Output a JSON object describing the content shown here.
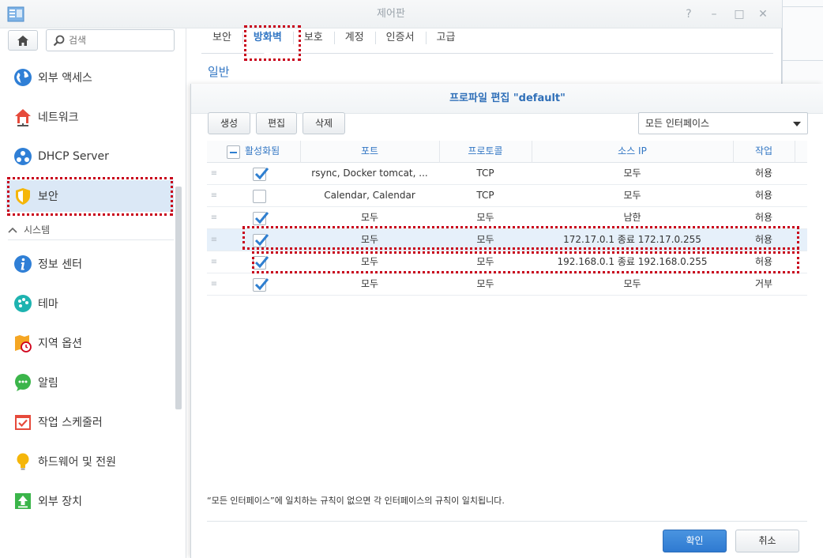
{
  "window": {
    "title": "제어판"
  },
  "sidebar": {
    "search_placeholder": "검색",
    "items": [
      {
        "label": "외부 액세스",
        "icon": "globe-icon"
      },
      {
        "label": "네트워크",
        "icon": "network-house-icon"
      },
      {
        "label": "DHCP Server",
        "icon": "dhcp-icon"
      },
      {
        "label": "보안",
        "icon": "shield-icon"
      },
      {
        "label": "정보 센터",
        "icon": "info-icon"
      },
      {
        "label": "테마",
        "icon": "palette-icon"
      },
      {
        "label": "지역 옵션",
        "icon": "map-clock-icon"
      },
      {
        "label": "알림",
        "icon": "chat-bubble-icon"
      },
      {
        "label": "작업 스케줄러",
        "icon": "calendar-check-icon"
      },
      {
        "label": "하드웨어 및 전원",
        "icon": "lightbulb-icon"
      },
      {
        "label": "외부 장치",
        "icon": "upload-arrow-icon"
      }
    ],
    "section_system": "시스템"
  },
  "tabs": [
    "보안",
    "방화벽",
    "보호",
    "계정",
    "인증서",
    "고급"
  ],
  "general_label": "일반",
  "dialog": {
    "title": "프로파일 편집 \"default\"",
    "toolbar": {
      "create": "생성",
      "edit": "편집",
      "delete": "삭제"
    },
    "interface_select": "모든 인터페이스",
    "columns": [
      "활성화됨",
      "포트",
      "프로토콜",
      "소스 IP",
      "작업"
    ],
    "rows": [
      {
        "enabled": true,
        "port": "rsync, Docker tomcat, ...",
        "protocol": "TCP",
        "source_ip": "모두",
        "action": "허용"
      },
      {
        "enabled": false,
        "port": "Calendar, Calendar",
        "protocol": "TCP",
        "source_ip": "모두",
        "action": "허용"
      },
      {
        "enabled": true,
        "port": "모두",
        "protocol": "모두",
        "source_ip": "남한",
        "action": "허용"
      },
      {
        "enabled": true,
        "port": "모두",
        "protocol": "모두",
        "source_ip": "172.17.0.1 종료 172.17.0.255",
        "action": "허용"
      },
      {
        "enabled": true,
        "port": "모두",
        "protocol": "모두",
        "source_ip": "192.168.0.1 종료 192.168.0.255",
        "action": "허용"
      },
      {
        "enabled": true,
        "port": "모두",
        "protocol": "모두",
        "source_ip": "모두",
        "action": "거부"
      }
    ],
    "footer_note": "“모든 인터페이스”에 일치하는 규칙이 없으면 각 인터페이스의 규칙이 일치됩니다.",
    "ok": "확인",
    "cancel": "취소"
  },
  "colors": {
    "accent": "#3377c4",
    "annotation": "#c8001a",
    "primary_button": "#2f7ad1"
  }
}
